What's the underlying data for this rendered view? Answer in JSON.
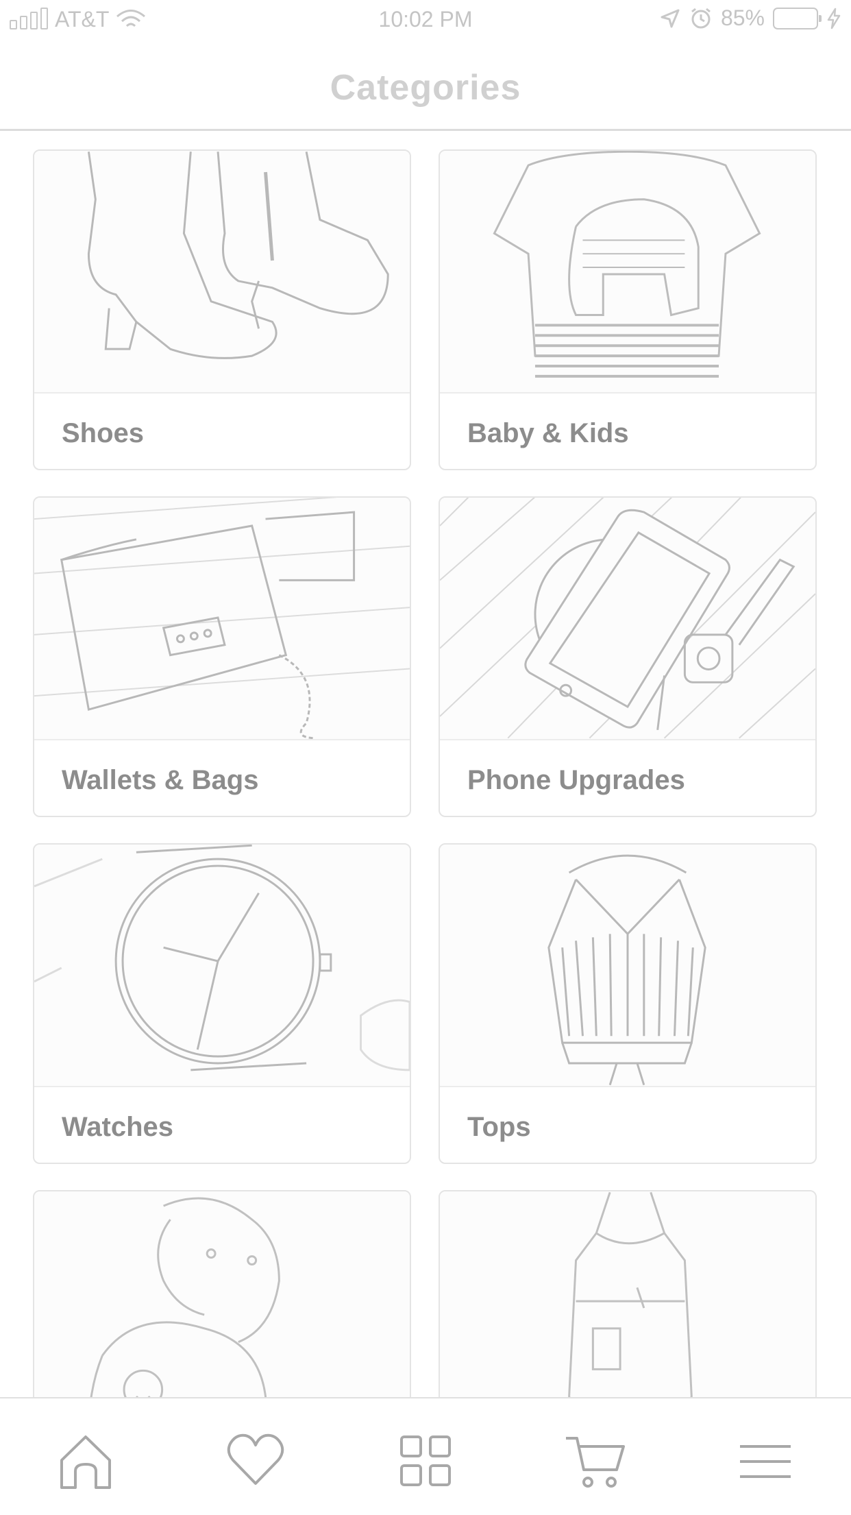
{
  "status_bar": {
    "carrier": "AT&T",
    "time": "10:02 PM",
    "battery": "85%"
  },
  "nav": {
    "title": "Categories"
  },
  "categories": [
    {
      "label": "Shoes"
    },
    {
      "label": "Baby & Kids"
    },
    {
      "label": "Wallets & Bags"
    },
    {
      "label": "Phone Upgrades"
    },
    {
      "label": "Watches"
    },
    {
      "label": "Tops"
    },
    {
      "label": ""
    },
    {
      "label": ""
    }
  ],
  "tab_bar": {
    "items": [
      {
        "icon": "home-icon"
      },
      {
        "icon": "heart-icon"
      },
      {
        "icon": "grid-icon"
      },
      {
        "icon": "cart-icon"
      },
      {
        "icon": "menu-icon"
      }
    ]
  },
  "colors": {
    "accent": "#c4c4c4",
    "text": "#8c8c8c",
    "border": "#e4e4e4"
  }
}
